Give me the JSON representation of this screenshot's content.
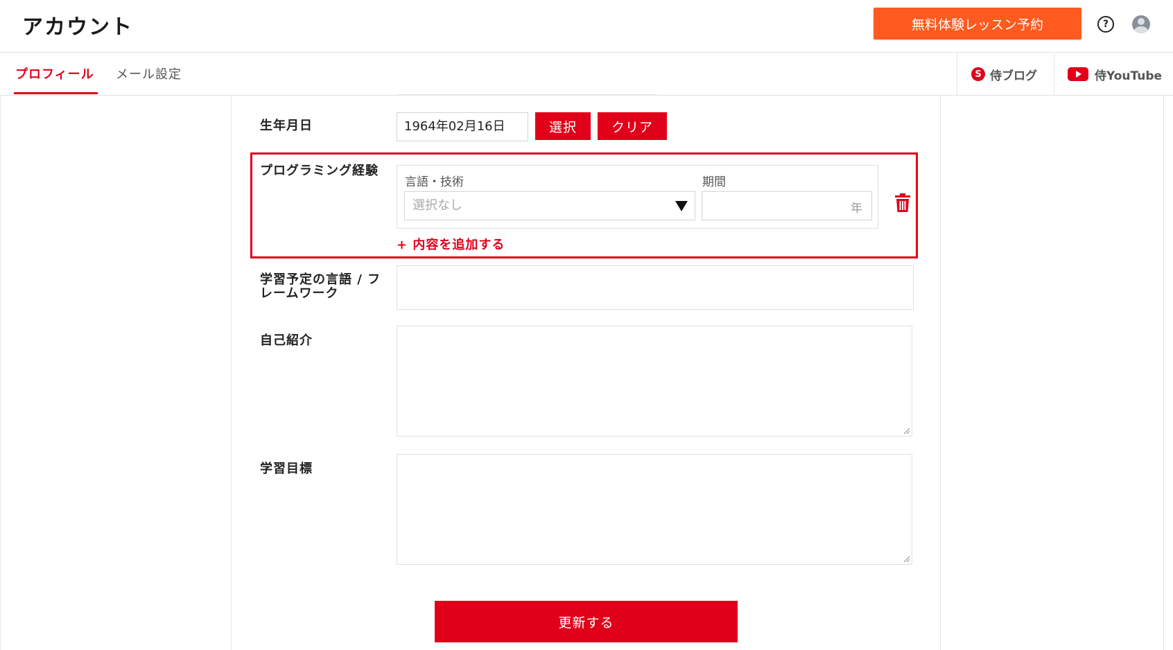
{
  "header": {
    "title": "アカウント",
    "trial_button": "無料体験レッスン予約",
    "help_icon": "help-circle-icon",
    "avatar_icon": "user-avatar-icon"
  },
  "tabs": {
    "profile": "プロフィール",
    "mail": "メール設定"
  },
  "external_links": {
    "blog": "侍ブログ",
    "blog_icon_glyph": "S",
    "youtube": "侍YouTube"
  },
  "form": {
    "birthday": {
      "label": "生年月日",
      "value": "1964年02月16日",
      "select_button": "選択",
      "clear_button": "クリア"
    },
    "programming_experience": {
      "label": "プログラミング経験",
      "language_label": "言語・技術",
      "language_placeholder": "選択なし",
      "period_label": "期間",
      "period_value": "",
      "period_suffix": "年",
      "add_link": "+ 内容を追加する"
    },
    "learning_languages": {
      "label_line1": "学習予定の言語 / フ",
      "label_line2": "レームワーク",
      "value": ""
    },
    "self_intro": {
      "label": "自己紹介",
      "value": ""
    },
    "learning_goal": {
      "label": "学習目標",
      "value": ""
    },
    "update_button": "更新する"
  },
  "colors": {
    "brand_red": "#e0001a",
    "trial_orange": "#ff5a1f"
  }
}
